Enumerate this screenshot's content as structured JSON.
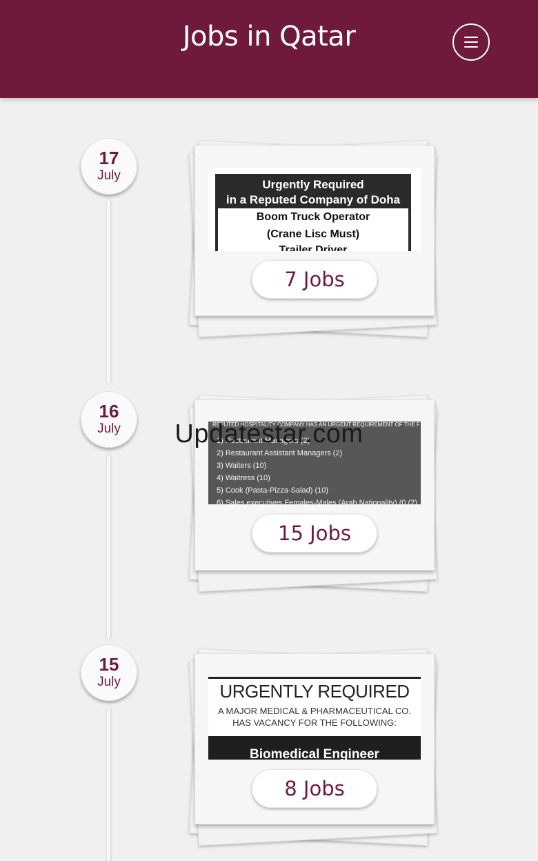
{
  "header": {
    "title": "Jobs in Qatar",
    "menu_icon": "hamburger-menu-icon",
    "background_color": "#6f1a3c"
  },
  "watermark": "Updatestar.com",
  "entries": [
    {
      "day": "17",
      "month": "July",
      "jobs_label": "7 Jobs",
      "thumbnail_lines": [
        "Urgently Required",
        "in a Reputed Company of Doha",
        "Boom Truck Operator",
        "(Crane Lisc Must)",
        "Trailer Driver"
      ]
    },
    {
      "day": "16",
      "month": "July",
      "jobs_label": "15 Jobs",
      "thumbnail_header": "REPUTED HOSPITALITY COMPANY HAS AN URGENT REQUIREMENT OF THE FF POSTS",
      "thumbnail_lines": [
        "1) Restaurant Managers (2)",
        "2) Restaurant Assistant Managers (2)",
        "3) Waiters (10)",
        "4) Waitress (10)",
        "5) Cook (Pasta-Pizza-Salad) (10)",
        "6) Sales executives Females-Males (Arab Nationality) (0 (2)"
      ]
    },
    {
      "day": "15",
      "month": "July",
      "jobs_label": "8 Jobs",
      "thumbnail_lines": [
        "URGENTLY REQUIRED",
        "A MAJOR MEDICAL & PHARMACEUTICAL CO.",
        "HAS VACANCY FOR THE FOLLOWING:",
        "Biomedical Engineer"
      ]
    }
  ]
}
